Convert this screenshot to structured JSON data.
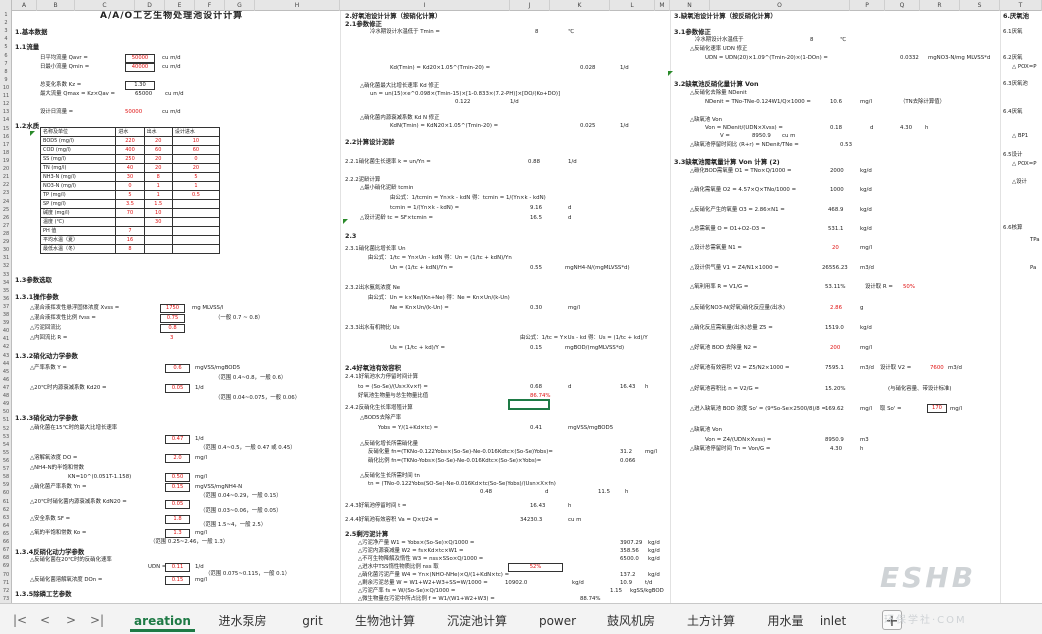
{
  "columns": [
    "A",
    "B",
    "C",
    "D",
    "E",
    "F",
    "G",
    "H",
    "I",
    "J",
    "K",
    "L",
    "M",
    "N",
    "O",
    "P",
    "Q",
    "R",
    "S",
    "T"
  ],
  "rows": [
    "1",
    "2",
    "3",
    "4",
    "5",
    "6",
    "7",
    "8",
    "9",
    "10",
    "11",
    "12",
    "13",
    "14",
    "15",
    "16",
    "17",
    "18",
    "19",
    "20",
    "21",
    "22",
    "23",
    "24",
    "25",
    "26",
    "27",
    "28",
    "29",
    "30",
    "31",
    "32",
    "33",
    "34",
    "35",
    "36",
    "37",
    "38",
    "39",
    "40",
    "41",
    "42",
    "43",
    "44",
    "45",
    "46",
    "47",
    "48",
    "49",
    "50",
    "51",
    "52",
    "53",
    "54",
    "55",
    "56",
    "57",
    "58",
    "59",
    "60",
    "61",
    "62",
    "63",
    "64",
    "65",
    "66",
    "67",
    "68",
    "69",
    "70",
    "71",
    "72",
    "73"
  ],
  "left": {
    "title": "A/A/O工艺生物处理池设计计算",
    "s1": "1.基本数据",
    "s11": "1.1流量",
    "qavr": "日平均流量 Qavr =",
    "qavr_val": "50000",
    "qavr_unit": "cu m/d",
    "qmin": "日最小流量 Qmin =",
    "qmin_val": "40000",
    "qmin_unit": "cu m/d",
    "kz": "总变化系数 Kz =",
    "kz_val": "1.30",
    "qmax": "最大流量 Qmax = Kz×Qav =",
    "qmax_val": "65000",
    "qmax_unit": "cu m/d",
    "design_q": "设计日流量 =",
    "design_q_val": "50000",
    "design_q_unit": "cu m/d",
    "s12": "1.2水质",
    "table_head": [
      "名称及单位",
      "进水",
      "出水",
      "设计进水"
    ],
    "table_rows": [
      [
        "BOD5 (mg/l)",
        "220",
        "20",
        "10"
      ],
      [
        "COD (mg/l)",
        "400",
        "60",
        "60"
      ],
      [
        "SS (mg/l)",
        "250",
        "20",
        "0"
      ],
      [
        "TN (mg/l)",
        "40",
        "20",
        "20"
      ],
      [
        "NH3-N (mg/l)",
        "30",
        "8",
        "5"
      ],
      [
        "NO3-N (mg/l)",
        "0",
        "1",
        "1"
      ],
      [
        "TP (mg/l)",
        "5",
        "1",
        "0.5"
      ],
      [
        "SP (mg/l)",
        "3.5",
        "1.5",
        ""
      ],
      [
        "碱度 (mg/l)",
        "70",
        "10",
        ""
      ],
      [
        "温度 (℃)",
        "",
        "30",
        ""
      ],
      [
        "PH 值",
        "7",
        "",
        ""
      ],
      [
        "平均水温（夏）",
        "16",
        "",
        ""
      ],
      [
        "最低水温（冬）",
        "8",
        "",
        ""
      ]
    ],
    "s13": "1.3参数选取",
    "s131": "1.3.1操作参数",
    "xvss": "△混合液挥发性悬浮固体浓度 Xvss =",
    "xvss_val": "1750",
    "xvss_unit": "mg MLVSS/l",
    "fvss": "△混合液挥发性比例 fvss =",
    "fvss_val": "0.75",
    "fvss_range": "（一般 0.7 ~ 0.8）",
    "sludge": "△污泥回流比",
    "sludge_val": "0.8",
    "inner": "△内回流比 R =",
    "inner_val": "3",
    "s132": "1.3.2硝化动力学参数",
    "y": "△产率系数 Y =",
    "y_val": "0.6",
    "y_unit": "mgVSS/mgBOD5",
    "y_range": "（范围 0.4~0.8，一般 0.6）",
    "kd": "△20℃时内源衰减系数 Kd20 =",
    "kd_val": "0.05",
    "kd_unit": "1/d",
    "kd_range": "（范围 0.04~0.075，一般 0.06）",
    "s133": "1.3.3硝化动力学参数",
    "mun": "△硝化菌在15℃时的最大比增长速率",
    "mun_val": "0.47",
    "mun_unit": "1/d",
    "mun_range": "（范围 0.4~0.5，一般 0.47 或 0.45）",
    "do": "△溶解氧浓度 DO =",
    "do_val": "2.0",
    "do_unit": "mg/l",
    "kn": "△NH4-N的半饱和常数",
    "kn_formula": "KN=10^(0.051T-1.158)",
    "kn_val": "0.50",
    "kn_unit": "mg/l",
    "yn": "△硝化菌产率系数 Yn =",
    "yn_val": "0.15",
    "yn_unit": "mgVSS/mgNH4-N",
    "yn_range": "（范围 0.04~0.29，一般 0.15）",
    "kdn": "△20℃时硝化菌内源衰减系数 KdN20 =",
    "kdn_val": "0.05",
    "kdn_range": "（范围 0.03~0.06，一般 0.05）",
    "sf": "△安全系数 SF =",
    "sf_val": "1.8",
    "sf_range": "（范围 1.5~4，一般 2.5）",
    "ko": "△氧的半饱和常数 Ko =",
    "ko_val": "1.3",
    "ko_unit": "mg/l",
    "ko_range": "（范围 0.25~2.46，一般 1.3）",
    "s134": "1.3.4反硝化动力学参数",
    "udn": "△反硝化菌在20℃时的反硝化速率",
    "udn_label": "UDN =",
    "udn_val": "0.11",
    "udn_unit": "1/d",
    "udn_range": "（范围 0.075~0.115，一般 0.1）",
    "don": "△反硝化菌溶解氧浓度 DOn =",
    "don_val": "0.15",
    "don_unit": "mg/l",
    "s135": "1.3.5除磷工艺参数"
  },
  "mid": {
    "s2": "2.好氧池设计计算（按硝化计算）",
    "s21": "2.1参数修正",
    "t1": "冷水期设计水温低于 Tmin =",
    "t1_val": "8",
    "t1_unit": "℃",
    "kd_eq": "Kd(Tmin) = Kd20×1.05^(Tmin-20) =",
    "kd_eq_val": "0.028",
    "kd_eq_unit": "1/d",
    "un_head": "△硝化菌最大比增长速率 Kd 修正",
    "un_eq": "un = un(15)×e^0.098×(Tmin-15)×[1-0.833×(7.2-PH)]×[DO/(Ko+DO)]",
    "un_val": "0.122",
    "un_unit": "1/d",
    "kdn_head": "△硝化菌内源衰减系数 Kd N 修正",
    "kdn_eq": "KdN(Tmin) = KdN20×1.05^(Tmin-20) =",
    "kdn_val": "0.025",
    "kdn_unit": "1/d",
    "s22": "2.2计算设计泥龄",
    "s221": "2.2.1硝化菌生长速率 k = un/Yn =",
    "s221_val": "0.88",
    "s221_unit": "1/d",
    "s222": "2.2.2泥龄计算",
    "tcmin": "△最小硝化泥龄 tcmin",
    "tcmin_eq": "由公式：1/tcmin = Yn×k - kdN  得：tcmin = 1/(Yn×k - kdN)",
    "tcmin_eq2": "tcmin = 1/(Yn×k - kdN) =",
    "tcmin_val": "9.16",
    "tcmin_unit": "d",
    "tc": "△设计泥龄  tc = SF×tcmin =",
    "tc_val": "16.5",
    "tc_unit": "d",
    "s23": "2.3",
    "s231": "2.3.1硝化菌比增长率 Un",
    "s231_eq": "由公式：1/tc = Yn×Un - kdN  得：Un = (1/tc + kdN)/Yn",
    "s231_eq2": "Un = (1/tc + kdN)/Yn =",
    "s231_val": "0.55",
    "s231_unit": "mgNH4-N/(mgMLVSS*d)",
    "s232": "2.3.2出水氨氮浓度 Ne",
    "s232_eq": "由公式：Un = k×Ne/(Kn+Ne)  得：Ne = Kn×Un/(k-Un)",
    "s232_eq2": "Ne = Kn×Un/(k-Un) =",
    "s232_val": "0.30",
    "s232_unit": "mg/l",
    "s233": "2.3.3出水有机物比 Us",
    "s233_eq": "由公式：1/tc = Y×Us - kd  得：Us = (1/tc + kd)/Y",
    "s233_eq2": "Us = (1/tc + kd)/Y =",
    "s233_val": "0.15",
    "s233_unit": "mgBOD/(mgMLVSS*d)",
    "s24": "2.4好氧池有效容积",
    "s241": "2.4.1好氧池水力停留时间计算",
    "to_eq": "to = (So-Se)/(Us×Xv×f) =",
    "to_val": "0.68",
    "to_unit": "d",
    "to_val2": "16.43",
    "to_unit2": "h",
    "frac": "好氧池生物量与总生物量比值",
    "frac_val": "86.74%",
    "s242": "2.4.2反硝化生长率增殖计算",
    "yobs_head": "△BOD5去除产率",
    "yobs": "Yobs = Y/(1+Kd×tc) =",
    "yobs_val": "0.41",
    "yobs_unit": "mgVSS/mgBOD5",
    "fn_head": "△反硝化增长所需硝化量",
    "fn_eq": "反硝化量 fn=(TKNo-0.122Yobs×(So-Se)-Ne-0.016Kdtc×(So-Se)Yobs)=",
    "fn_val": "31.2",
    "fn_unit": "mg/l",
    "fn_eq2": "硝化比例 fn=(TKNo-Yobs×(So-Se)-Ne-0.016Kdtc×(So-Se)×Yobs)=",
    "fn_val2": "0.066",
    "tn_head": "△反硝化生长所需时间 tn",
    "tn_eq": "tn = (TNo-0.122Yobs(SO-Se)-Ne-0.016Kd×tc(So-Se)Yobs)/(Usn×X×fn)",
    "tn_val": "0.48",
    "tn_unit": "d",
    "tn_val2": "11.5",
    "tn_unit2": "h",
    "s243": "2.4.3好氧池停留时间  t =",
    "s243_val": "16.43",
    "s243_unit": "h",
    "s244": "2.4.4好氧池有效容积  Va = Q×t/24 =",
    "s244_val": "34230.3",
    "s244_unit": "cu m",
    "s25": "2.5剩污泥计算",
    "r1": "△污泥净产量     W1 = Yobs×(So-Se)×Q/1000 =",
    "r1_val": "3907.29",
    "r1_unit": "kg/d",
    "r2": "△污泥内源衰减量 W2 = fs×Kd×tc×W1 =",
    "r2_val": "358.56",
    "r2_unit": "kg/d",
    "r3": "△不可生物降解及惰性 W3 = nss×SSo×Q/1000 =",
    "r3_val": "6500.0",
    "r3_unit": "kg/d",
    "r4": "△进水中TSS惰性物质比例 nss 取",
    "r4_val": "52%",
    "r5": "△硝化菌污泥产量  W4 = Yn×(NHO-NHe)×Q/(1+KdN×tc) =",
    "r5_val": "137.2",
    "r5_unit": "kg/d",
    "r6": "△剩余污泥总量 W = W1+W2+W3+SS=W/1000 =",
    "r6_val": "10902.0",
    "r6_unit": "kg/d",
    "r6_val2": "10.9",
    "r6_unit2": "t/d",
    "r7": "△污泥产率 fs = W/(So-Se)×Q/1000 =",
    "r7_val": "1.15",
    "r7_unit": "kgSS/kgBOD",
    "r8": "△微生物量在污泥中所占比例 f = W1/(W1+W2+W3) =",
    "r8_val": "88.74%",
    "s26": "2.6污泥中MLVSS比例 fvss = (W1/fvss)/W =",
    "s26_val": "0.2586",
    "s26_val2": "0.36"
  },
  "right": {
    "s3": "3.缺氧池设计计算（按反硝化计算）",
    "s31": "3.1参数修正",
    "t1": "冷水期设计水温低于",
    "t1_val": "8",
    "t1_unit": "℃",
    "udn_head": "△反硝化速率 UDN 修正",
    "udn_eq": "UDN = UDN(20)×1.09^(Tmin-20)×(1-DOn) =",
    "udn_val": "0.0332",
    "udn_unit": "mgNO3-N/mg MLVSS*d",
    "s32": "3.2缺氧池反硝化量计算 Von",
    "denit_head": "△反硝化去除量 NDenit",
    "denit_eq": "NDenit = TNo-TNe-0.124W1/Q×1000 =",
    "denit_val": "10.6",
    "denit_unit": "mg/l",
    "denit_note": "（TN去除计算值）",
    "von_head": "△缺氧池 Von",
    "von_eq": "Von = NDenit/(UDN×Xvss) =",
    "von_val": "0.18",
    "von_unit": "d",
    "von_val2": "4.30",
    "von_unit2": "h",
    "von_v": "V =",
    "von_v_val": "8950.9",
    "von_v_unit": "cu m",
    "ratio": "△缺氧池停留时间比 (R+r) = NDenit/TNe =",
    "ratio_val": "0.53",
    "s33": "3.3缺氧池需氧量计算 Von 计算 (2)",
    "o1": "△碳化BOD需氧量 O1 = TNo×Q/1000 =",
    "o1_val": "2000",
    "o1_unit": "kg/d",
    "o2": "△硝化需氧量 O2 = 4.57×Q×TNo/1000 =",
    "o2_val": "1000",
    "o2_unit": "kg/d",
    "o3": "△反硝化产生的氧量 O3 = 2.86×N1 =",
    "o3_val": "468.9",
    "o3_unit": "kg/d",
    "o4": "△总需氧量 O = O1+O2-O3 =",
    "o4_val": "531.1",
    "o4_unit": "kg/d",
    "o5": "△设计总需氧量 N1 =",
    "o5_val": "20",
    "o5_unit": "mg/l",
    "o6": "△设计供气量 V1 = Z4/N1×1000 =",
    "o6_val": "26556.23",
    "o6_unit": "m3/d",
    "o7": "△氧利用率 R = V1/G =",
    "o7_val": "53.11%",
    "o7_note": "设计取 R =",
    "o7_note_val": "50%",
    "o8": "△反硝化NO3-N(好氧)硝化反应量(出水)",
    "o8_val": "2.86",
    "o8_unit": "g",
    "o9": "△硝化反应需氧量(出水)总量 Z5 =",
    "o9_val": "1519.0",
    "o9_unit": "kg/d",
    "o10": "△好氧池 BOD 去除量 N2 =",
    "o10_val": "200",
    "o10_unit": "mg/l",
    "o11": "△好氧池有效容积 V2 = Z5/N2×1000 =",
    "o11_val": "7595.1",
    "o11_unit": "m3/d",
    "o11_note": "设计取 V2 =",
    "o11_note_val": "7600",
    "o11_note_unit": "m3/d",
    "o12": "△好氧池容积比 n = V2/G =",
    "o12_val": "15.20%",
    "o12_note": "(与硝化容量、带设计标准)",
    "o13": "△进入缺氧池 BOD 浓度 So' = (9*So-Se×2500/8)/8 =",
    "o13_val": "169.62",
    "o13_unit": "mg/l",
    "o13_note": "取 So' =",
    "o13_note_val": "170",
    "o13_note_unit": "mg/l",
    "von2_head": "△缺氧池 Von",
    "von2": "Von = Z4/(UDN×Xvss) =",
    "von2_val": "8950.9",
    "von2_unit": "m3",
    "tn2": "△缺氧池停留时间 Tn = Von/G =",
    "tn2_val": "4.30",
    "tn2_unit": "h"
  },
  "far": {
    "s6": "6.厌氧池",
    "s61": "6.1厌氧",
    "s62": "6.2厌氧",
    "pox": "△ POX=P",
    "s63": "6.3厌氧池",
    "bp": "△ BP1",
    "s64": "6.4厌氧",
    "s65": "6.5设计",
    "pox2": "△ POX=P",
    "calc": "△设计",
    "s66": "6.6核算",
    "tpa": "TPa",
    "pa": "Pa"
  },
  "sheet_tabs": [
    "areation",
    "进水泵房",
    "grit",
    "生物池计算",
    "沉淀池计算",
    "power",
    "鼓风机房",
    "土方计算",
    "用水量",
    "inlet"
  ],
  "active_tab": "areation",
  "nav": {
    "first": "|<",
    "prev": "<",
    "next": ">",
    "last": ">|"
  },
  "add_sheet": "+",
  "watermark": {
    "logo": "ESHB",
    "sub": "环保学社·COM"
  },
  "colors": {
    "accent": "#1e7a45",
    "value_red": "#e01010"
  }
}
